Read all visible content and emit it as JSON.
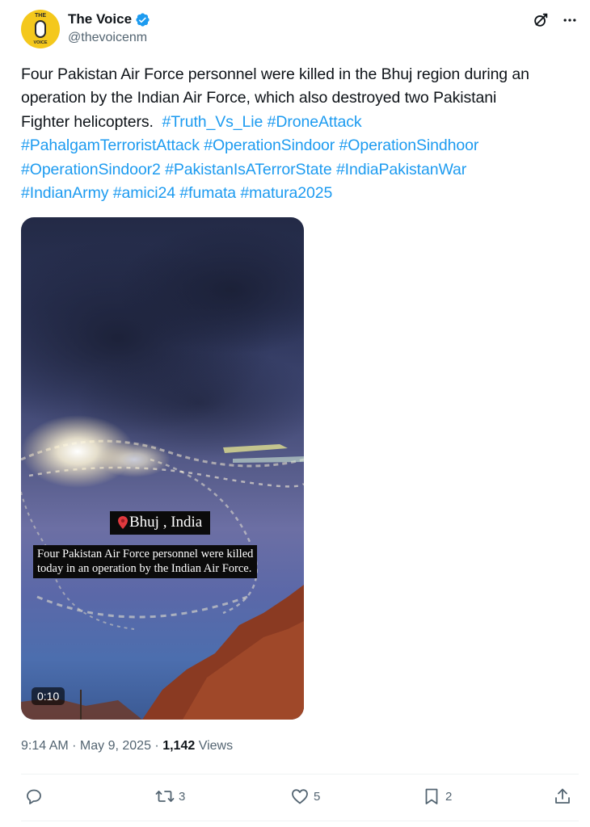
{
  "author": {
    "name": "The Voice",
    "handle": "@thevoicenm",
    "avatar_text_top": "THE",
    "avatar_text_bottom": "VOICE",
    "avatar_color": "#f4c81c",
    "verified": true
  },
  "tweet": {
    "lines": [
      [
        {
          "t": "Four Pakistan Air Force personnel were killed in the Bhuj region during an",
          "tag": false
        }
      ],
      [
        {
          "t": "operation by the Indian Air Force, which also destroyed two Pakistani",
          "tag": false
        }
      ],
      [
        {
          "t": "Fighter helicopters.  ",
          "tag": false
        },
        {
          "t": "#Truth_Vs_Lie",
          "tag": true
        },
        {
          "t": " ",
          "tag": false
        },
        {
          "t": "#DroneAttack",
          "tag": true
        }
      ],
      [
        {
          "t": "#PahalgamTerroristAttack",
          "tag": true
        },
        {
          "t": " ",
          "tag": false
        },
        {
          "t": "#OperationSindoor",
          "tag": true
        },
        {
          "t": " ",
          "tag": false
        },
        {
          "t": "#OperationSindhoor",
          "tag": true
        }
      ],
      [
        {
          "t": "#OperationSindoor2",
          "tag": true
        },
        {
          "t": " ",
          "tag": false
        },
        {
          "t": "#PakistanIsATerrorState",
          "tag": true
        },
        {
          "t": " ",
          "tag": false
        },
        {
          "t": "#IndiaPakistanWar",
          "tag": true
        }
      ],
      [
        {
          "t": "#IndianArmy",
          "tag": true
        },
        {
          "t": " ",
          "tag": false
        },
        {
          "t": "#amici24",
          "tag": true
        },
        {
          "t": " ",
          "tag": false
        },
        {
          "t": "#fumata",
          "tag": true
        },
        {
          "t": " ",
          "tag": false
        },
        {
          "t": "#matura2025",
          "tag": true
        }
      ]
    ],
    "hashtag_color": "#1d9bf0"
  },
  "media": {
    "location_label": "Bhuj , India",
    "caption_lines": [
      "Four Pakistan Air Force personnel were killed",
      "today in an operation by the Indian Air Force."
    ],
    "duration": "0:10"
  },
  "meta": {
    "time": "9:14 AM",
    "separator": " · ",
    "date": "May 9, 2025",
    "views_count": "1,142",
    "views_label": " Views"
  },
  "actions": {
    "replies": "",
    "reposts": "3",
    "likes": "5",
    "bookmarks": "2"
  },
  "icons": {
    "top": [
      "grok-icon",
      "more-icon"
    ],
    "actions": [
      "reply-icon",
      "repost-icon",
      "like-icon",
      "bookmark-icon",
      "share-icon"
    ]
  }
}
